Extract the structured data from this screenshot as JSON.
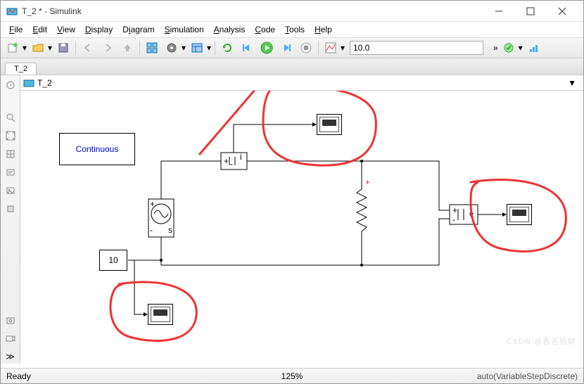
{
  "window": {
    "title": "T_2 * - Simulink"
  },
  "menu": {
    "file": "File",
    "edit": "Edit",
    "view": "View",
    "display": "Display",
    "diagram": "Diagram",
    "simulation": "Simulation",
    "analysis": "Analysis",
    "code": "Code",
    "tools": "Tools",
    "help": "Help"
  },
  "toolbar": {
    "stop_time": "10.0"
  },
  "tabs": {
    "t0": "T_2"
  },
  "breadcrumb": {
    "name": "T_2"
  },
  "blocks": {
    "continuous_label": "Continuous",
    "constant_value": "10",
    "current_sensor_plus": "+",
    "current_sensor_i": "i",
    "voltage_sensor_plus": "+",
    "voltage_sensor_v": "v",
    "resistor_plus": "+"
  },
  "status": {
    "left": "Ready",
    "zoom": "125%",
    "solver": "auto(VariableStepDiscrete)"
  },
  "icons": {
    "app": "simulink"
  },
  "annotations": {
    "color": "#e33"
  },
  "watermark": "CSDN @吾名招财"
}
